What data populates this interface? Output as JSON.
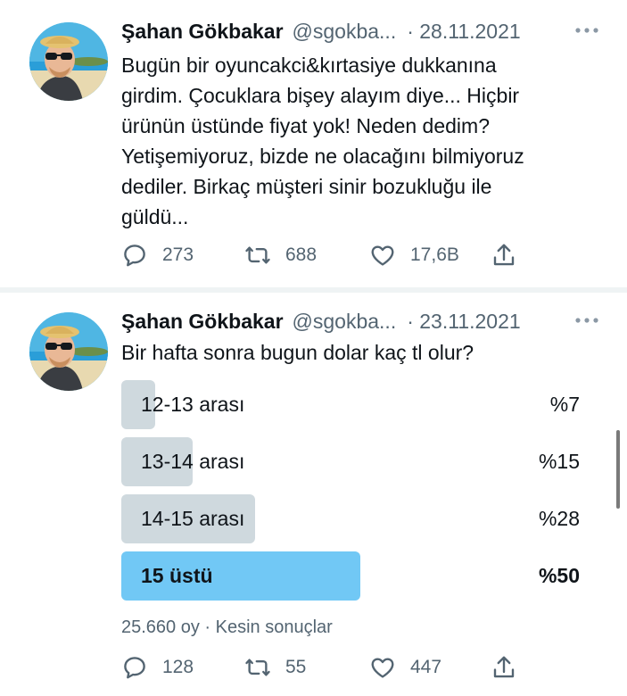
{
  "tweets": [
    {
      "name": "Şahan Gökbakar",
      "handle": "@sgokba...",
      "date": "· 28.11.2021",
      "text": "Bugün bir oyuncakci&kırtasiye dukkanına\ngirdim. Çocuklara bişey alayım diye... Hiçbir\nürünün üstünde fiyat yok! Neden dedim?\nYetişemiyoruz, bizde ne olacağını bilmiyoruz\ndediler. Birkaç müşteri sinir bozukluğu ile\ngüldü...",
      "replies": "273",
      "retweets": "688",
      "likes": "17,6B"
    },
    {
      "name": "Şahan Gökbakar",
      "handle": "@sgokba...",
      "date": "· 23.11.2021",
      "text": "Bir hafta sonra bugun dolar kaç tl olur?",
      "poll": {
        "options": [
          {
            "label": "12-13 arası",
            "percent_text": "%7",
            "percent": 7,
            "winner": false
          },
          {
            "label": "13-14 arası",
            "percent_text": "%15",
            "percent": 15,
            "winner": false
          },
          {
            "label": "14-15 arası",
            "percent_text": "%28",
            "percent": 28,
            "winner": false
          },
          {
            "label": "15 üstü",
            "percent_text": "%50",
            "percent": 50,
            "winner": true
          }
        ],
        "meta": "25.660 oy · Kesin sonuçlar"
      },
      "replies": "128",
      "retweets": "55",
      "likes": "447"
    }
  ],
  "icons": {
    "more": "more-dots-icon",
    "reply": "reply-icon",
    "retweet": "retweet-icon",
    "like": "heart-icon",
    "share": "share-icon"
  },
  "colors": {
    "poll_winner": "#71c8f5",
    "poll_bar": "#cfd9de",
    "secondary_text": "#536471"
  }
}
